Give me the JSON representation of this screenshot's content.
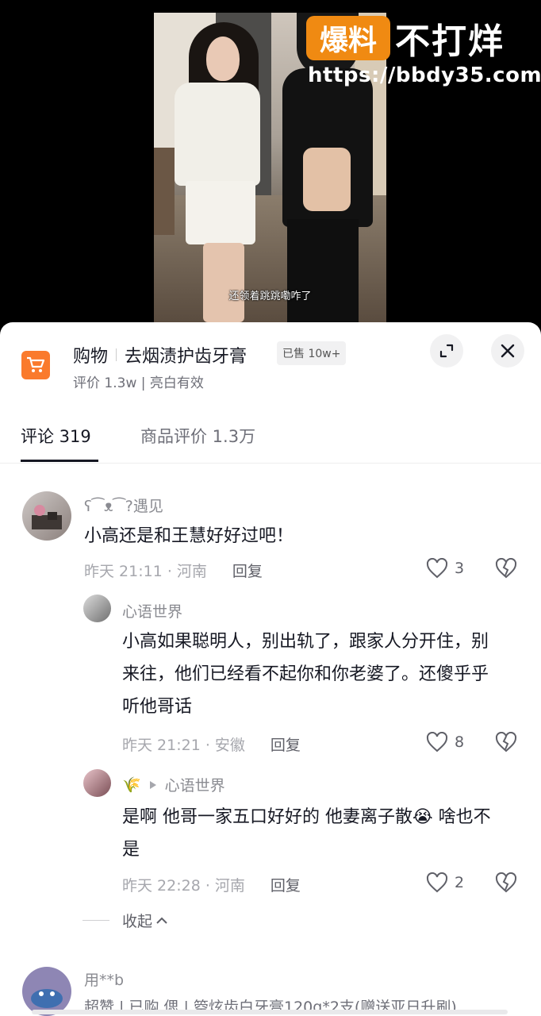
{
  "video": {
    "subtitle": "还领着跳跳嘞咋了",
    "watermark_badge": "爆料",
    "watermark_text": "不打烊",
    "watermark_url": "https://bbdy35.com"
  },
  "product": {
    "category": "购物",
    "name": "去烟渍护齿牙膏",
    "sold_badge": "已售 10w+",
    "subtitle": "评价 1.3w | 亮白有效",
    "icons": [
      "cart-icon",
      "expand-icon",
      "close-icon"
    ]
  },
  "tabs": [
    {
      "label": "评论 319",
      "active": true
    },
    {
      "label": "商品评价 1.3万",
      "active": false
    }
  ],
  "comments": [
    {
      "user": "ʕ⁀ᴥ⁀?遇见",
      "text": "小高还是和王慧好好过吧！",
      "time": "昨天 21:11 · 河南",
      "reply_label": "回复",
      "likes": "3"
    },
    {
      "user": "心语世界",
      "text": "小高如果聪明人，别出轨了，跟家人分开住，别来往，他们已经看不起你和你老婆了。还傻乎乎听他哥话",
      "time": "昨天 21:21 · 安徽",
      "reply_label": "回复",
      "likes": "8"
    },
    {
      "user_emoji": "🌾",
      "reply_to": "心语世界",
      "text": "是啊  他哥一家五口好好的  他妻离子散😭 啥也不是",
      "time": "昨天 22:28 · 河南",
      "reply_label": "回复",
      "likes": "2"
    }
  ],
  "collapse_label": "收起",
  "next_comment": {
    "user": "用**b",
    "text": "超赞 | 已购 偲 | 箜炫齿白牙膏120g*2支(赠送亚日升刷)"
  },
  "colors": {
    "accent": "#fa7a2c",
    "watermark": "#f08a12",
    "text": "#161823",
    "muted": "#8a8b91"
  }
}
